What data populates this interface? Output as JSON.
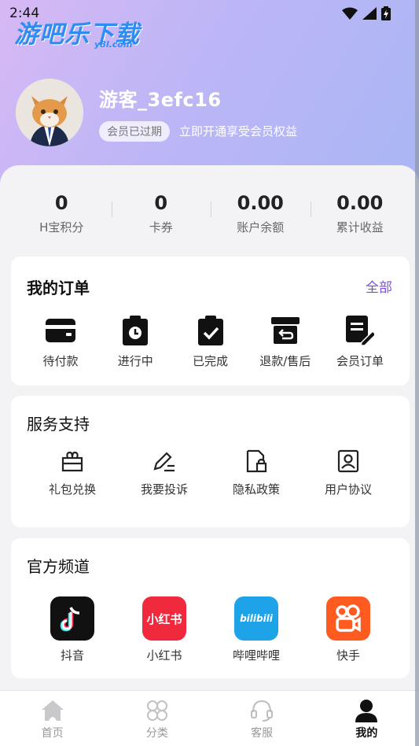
{
  "status_bar": {
    "time": "2:44"
  },
  "watermark": {
    "text": "游吧乐下载",
    "sub": "y8l.com"
  },
  "profile": {
    "username": "游客_3efc16",
    "vip_status": "会员已过期",
    "vip_prompt": "立即开通享受会员权益"
  },
  "stats": [
    {
      "value": "0",
      "label": "H宝积分"
    },
    {
      "value": "0",
      "label": "卡券"
    },
    {
      "value": "0.00",
      "label": "账户余额"
    },
    {
      "value": "0.00",
      "label": "累计收益"
    }
  ],
  "orders": {
    "title": "我的订单",
    "more": "全部",
    "items": [
      {
        "label": "待付款",
        "icon": "wallet-icon"
      },
      {
        "label": "进行中",
        "icon": "clipboard-clock-icon"
      },
      {
        "label": "已完成",
        "icon": "clipboard-check-icon"
      },
      {
        "label": "退款/售后",
        "icon": "return-box-icon"
      },
      {
        "label": "会员订单",
        "icon": "document-edit-icon"
      }
    ]
  },
  "services": {
    "title": "服务支持",
    "items": [
      {
        "label": "礼包兑换",
        "icon": "gift-icon"
      },
      {
        "label": "我要投诉",
        "icon": "pen-icon"
      },
      {
        "label": "隐私政策",
        "icon": "privacy-lock-icon"
      },
      {
        "label": "用户协议",
        "icon": "user-agreement-icon"
      }
    ]
  },
  "channels": {
    "title": "官方频道",
    "items": [
      {
        "label": "抖音",
        "icon": "douyin-icon",
        "color": "#111111"
      },
      {
        "label": "小红书",
        "icon": "xiaohongshu-icon",
        "color": "#f0293d",
        "glyph": "小红书"
      },
      {
        "label": "哔哩哔哩",
        "icon": "bilibili-icon",
        "color": "#1fa3e8",
        "glyph": "bilibili"
      },
      {
        "label": "快手",
        "icon": "kuaishou-icon",
        "color": "#ff5a1f"
      }
    ]
  },
  "bottom_nav": [
    {
      "label": "首页",
      "icon": "home-icon",
      "active": false
    },
    {
      "label": "分类",
      "icon": "category-icon",
      "active": false
    },
    {
      "label": "客服",
      "icon": "headset-icon",
      "active": false
    },
    {
      "label": "我的",
      "icon": "profile-icon",
      "active": true
    }
  ]
}
